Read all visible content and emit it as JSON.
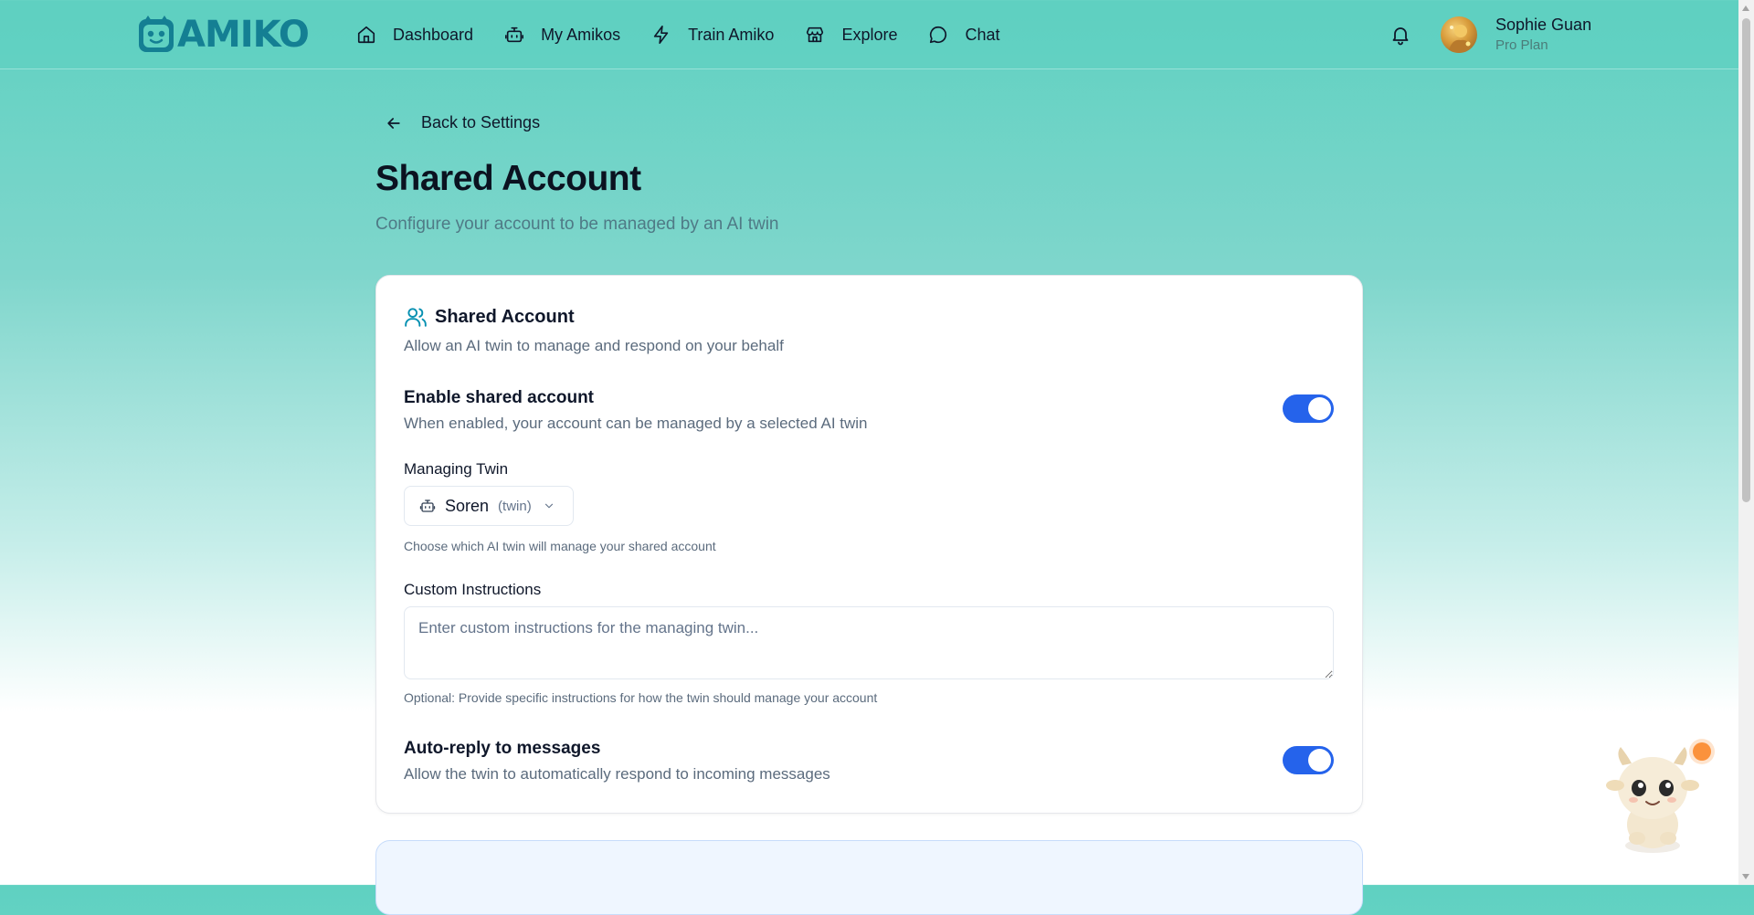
{
  "header": {
    "logo_text": "AMIKO",
    "nav": [
      {
        "label": "Dashboard",
        "icon": "home-icon"
      },
      {
        "label": "My Amikos",
        "icon": "bot-icon"
      },
      {
        "label": "Train Amiko",
        "icon": "lightning-icon"
      },
      {
        "label": "Explore",
        "icon": "store-icon"
      },
      {
        "label": "Chat",
        "icon": "chat-bubble-icon"
      }
    ],
    "user": {
      "name": "Sophie Guan",
      "plan": "Pro Plan"
    }
  },
  "page": {
    "back_label": "Back to Settings",
    "title": "Shared Account",
    "subtitle": "Configure your account to be managed by an AI twin"
  },
  "card": {
    "title": "Shared Account",
    "description": "Allow an AI twin to manage and respond on your behalf",
    "enable": {
      "title": "Enable shared account",
      "description": "When enabled, your account can be managed by a selected AI twin",
      "on": true
    },
    "managing_twin": {
      "label": "Managing Twin",
      "value": "Soren",
      "tag": "(twin)",
      "help": "Choose which AI twin will manage your shared account"
    },
    "custom_instructions": {
      "label": "Custom Instructions",
      "placeholder": "Enter custom instructions for the managing twin...",
      "value": "",
      "help": "Optional: Provide specific instructions for how the twin should manage your account"
    },
    "auto_reply": {
      "title": "Auto-reply to messages",
      "description": "Allow the twin to automatically respond to incoming messages",
      "on": true
    }
  },
  "colors": {
    "accent": "#2563eb",
    "brand": "#147f93",
    "header_bg": "#5fd1c1",
    "notification": "#fb923c"
  }
}
